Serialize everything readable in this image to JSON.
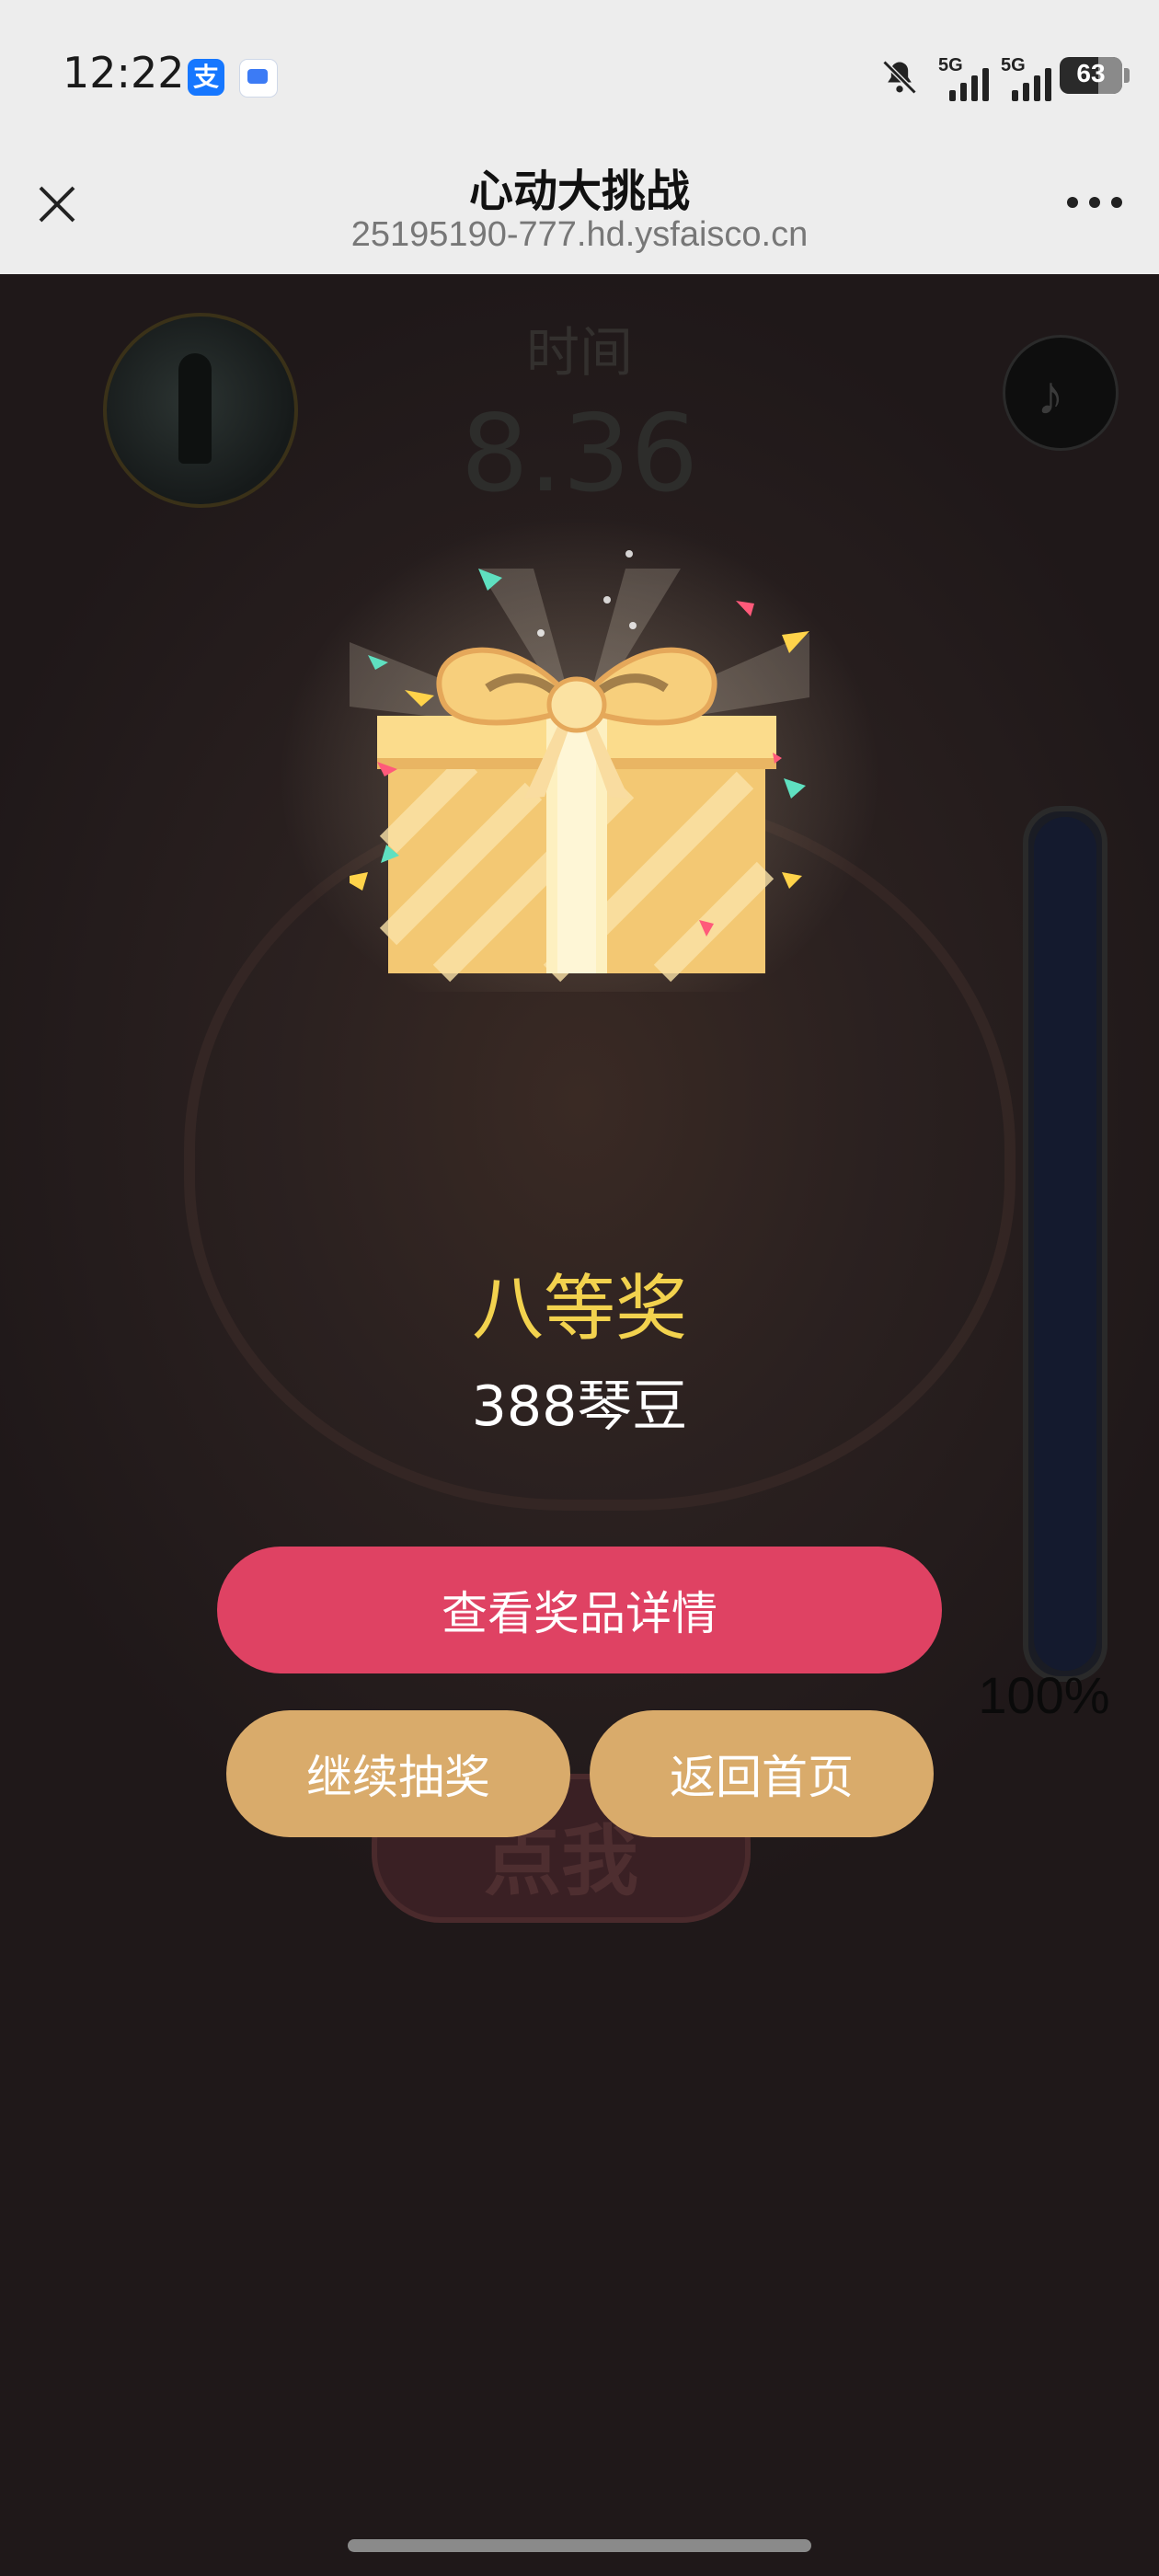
{
  "status_bar": {
    "time": "12:22",
    "network_1": "5G",
    "network_2": "5G",
    "battery": "63",
    "icons": [
      "alipay-icon",
      "message-icon",
      "bell-off-icon",
      "signal-icon",
      "battery-icon"
    ]
  },
  "nav": {
    "title": "心动大挑战",
    "url": "25195190-777.hd.ysfaisco.cn",
    "close_icon": "close-icon",
    "more_icon": "more-icon"
  },
  "game": {
    "time_label": "时间",
    "time_value": "8.36",
    "click_label": "点我",
    "progress_text": "100%",
    "progress_fraction": 1.0
  },
  "prize": {
    "title": "八等奖",
    "description": "388琴豆"
  },
  "buttons": {
    "view_details": "查看奖品详情",
    "continue_draw": "继续抽奖",
    "back_home": "返回首页"
  },
  "colors": {
    "primary_button": "#df4263",
    "gold_button": "#d9ab6b",
    "prize_title": "#f2d24e"
  }
}
